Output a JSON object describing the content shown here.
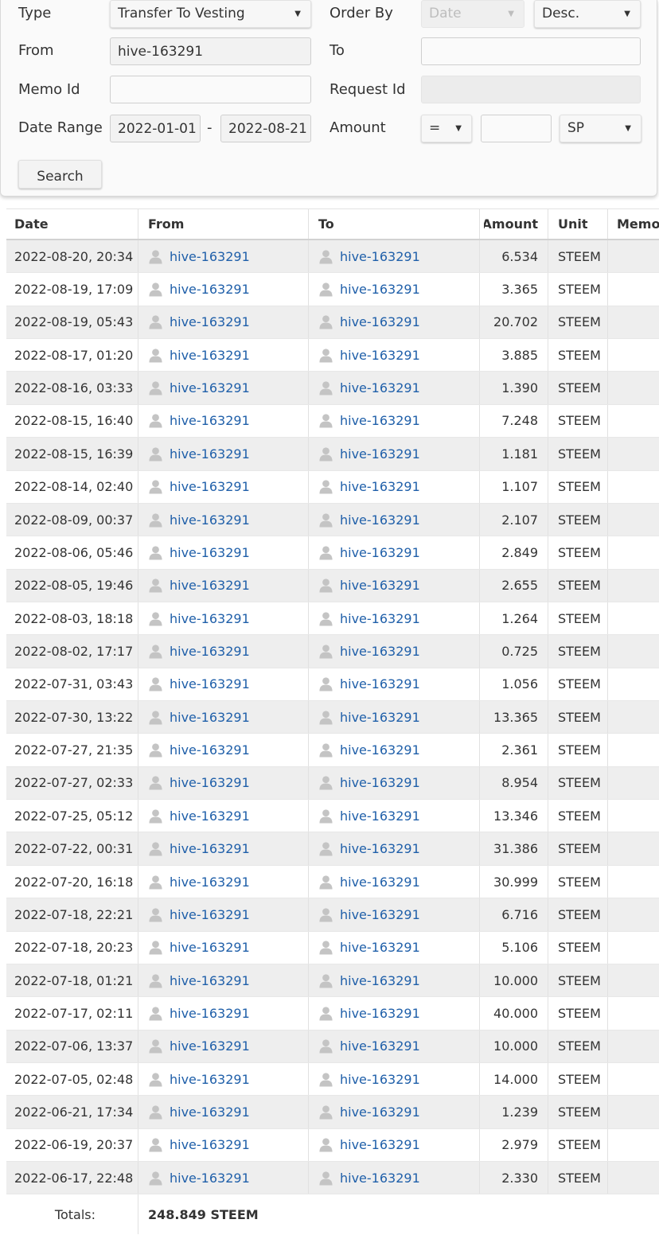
{
  "filters": {
    "type_label": "Type",
    "type_value": "Transfer To Vesting",
    "order_by_label": "Order By",
    "order_by_value": "Date",
    "order_dir_value": "Desc.",
    "from_label": "From",
    "from_value": "hive-163291",
    "to_label": "To",
    "to_value": "",
    "memo_id_label": "Memo Id",
    "memo_id_value": "",
    "request_id_label": "Request Id",
    "request_id_value": "",
    "date_range_label": "Date Range",
    "date_start": "2022-01-01",
    "date_sep": "-",
    "date_end": "2022-08-21",
    "amount_label": "Amount",
    "amount_op": "=",
    "amount_value": "",
    "amount_unit": "SP",
    "search_label": "Search"
  },
  "table": {
    "headers": {
      "date": "Date",
      "from": "From",
      "to": "To",
      "amount": "Amount",
      "unit": "Unit",
      "memo": "Memo"
    },
    "rows": [
      {
        "date": "2022-08-20, 20:34",
        "from": "hive-163291",
        "to": "hive-163291",
        "amount": "6.534",
        "unit": "STEEM"
      },
      {
        "date": "2022-08-19, 17:09",
        "from": "hive-163291",
        "to": "hive-163291",
        "amount": "3.365",
        "unit": "STEEM"
      },
      {
        "date": "2022-08-19, 05:43",
        "from": "hive-163291",
        "to": "hive-163291",
        "amount": "20.702",
        "unit": "STEEM"
      },
      {
        "date": "2022-08-17, 01:20",
        "from": "hive-163291",
        "to": "hive-163291",
        "amount": "3.885",
        "unit": "STEEM"
      },
      {
        "date": "2022-08-16, 03:33",
        "from": "hive-163291",
        "to": "hive-163291",
        "amount": "1.390",
        "unit": "STEEM"
      },
      {
        "date": "2022-08-15, 16:40",
        "from": "hive-163291",
        "to": "hive-163291",
        "amount": "7.248",
        "unit": "STEEM"
      },
      {
        "date": "2022-08-15, 16:39",
        "from": "hive-163291",
        "to": "hive-163291",
        "amount": "1.181",
        "unit": "STEEM"
      },
      {
        "date": "2022-08-14, 02:40",
        "from": "hive-163291",
        "to": "hive-163291",
        "amount": "1.107",
        "unit": "STEEM"
      },
      {
        "date": "2022-08-09, 00:37",
        "from": "hive-163291",
        "to": "hive-163291",
        "amount": "2.107",
        "unit": "STEEM"
      },
      {
        "date": "2022-08-06, 05:46",
        "from": "hive-163291",
        "to": "hive-163291",
        "amount": "2.849",
        "unit": "STEEM"
      },
      {
        "date": "2022-08-05, 19:46",
        "from": "hive-163291",
        "to": "hive-163291",
        "amount": "2.655",
        "unit": "STEEM"
      },
      {
        "date": "2022-08-03, 18:18",
        "from": "hive-163291",
        "to": "hive-163291",
        "amount": "1.264",
        "unit": "STEEM"
      },
      {
        "date": "2022-08-02, 17:17",
        "from": "hive-163291",
        "to": "hive-163291",
        "amount": "0.725",
        "unit": "STEEM"
      },
      {
        "date": "2022-07-31, 03:43",
        "from": "hive-163291",
        "to": "hive-163291",
        "amount": "1.056",
        "unit": "STEEM"
      },
      {
        "date": "2022-07-30, 13:22",
        "from": "hive-163291",
        "to": "hive-163291",
        "amount": "13.365",
        "unit": "STEEM"
      },
      {
        "date": "2022-07-27, 21:35",
        "from": "hive-163291",
        "to": "hive-163291",
        "amount": "2.361",
        "unit": "STEEM"
      },
      {
        "date": "2022-07-27, 02:33",
        "from": "hive-163291",
        "to": "hive-163291",
        "amount": "8.954",
        "unit": "STEEM"
      },
      {
        "date": "2022-07-25, 05:12",
        "from": "hive-163291",
        "to": "hive-163291",
        "amount": "13.346",
        "unit": "STEEM"
      },
      {
        "date": "2022-07-22, 00:31",
        "from": "hive-163291",
        "to": "hive-163291",
        "amount": "31.386",
        "unit": "STEEM"
      },
      {
        "date": "2022-07-20, 16:18",
        "from": "hive-163291",
        "to": "hive-163291",
        "amount": "30.999",
        "unit": "STEEM"
      },
      {
        "date": "2022-07-18, 22:21",
        "from": "hive-163291",
        "to": "hive-163291",
        "amount": "6.716",
        "unit": "STEEM"
      },
      {
        "date": "2022-07-18, 20:23",
        "from": "hive-163291",
        "to": "hive-163291",
        "amount": "5.106",
        "unit": "STEEM"
      },
      {
        "date": "2022-07-18, 01:21",
        "from": "hive-163291",
        "to": "hive-163291",
        "amount": "10.000",
        "unit": "STEEM"
      },
      {
        "date": "2022-07-17, 02:11",
        "from": "hive-163291",
        "to": "hive-163291",
        "amount": "40.000",
        "unit": "STEEM"
      },
      {
        "date": "2022-07-06, 13:37",
        "from": "hive-163291",
        "to": "hive-163291",
        "amount": "10.000",
        "unit": "STEEM"
      },
      {
        "date": "2022-07-05, 02:48",
        "from": "hive-163291",
        "to": "hive-163291",
        "amount": "14.000",
        "unit": "STEEM"
      },
      {
        "date": "2022-06-21, 17:34",
        "from": "hive-163291",
        "to": "hive-163291",
        "amount": "1.239",
        "unit": "STEEM"
      },
      {
        "date": "2022-06-19, 20:37",
        "from": "hive-163291",
        "to": "hive-163291",
        "amount": "2.979",
        "unit": "STEEM"
      },
      {
        "date": "2022-06-17, 22:48",
        "from": "hive-163291",
        "to": "hive-163291",
        "amount": "2.330",
        "unit": "STEEM"
      }
    ],
    "totals_label": "Totals:",
    "totals_value": "248.849 STEEM"
  },
  "colors": {
    "link": "#1f5fa9",
    "row_alt": "#eeeeee",
    "icon": "#c4c4c4"
  },
  "icons": {
    "user": "user-icon",
    "dropdown": "chevron-down-icon"
  }
}
